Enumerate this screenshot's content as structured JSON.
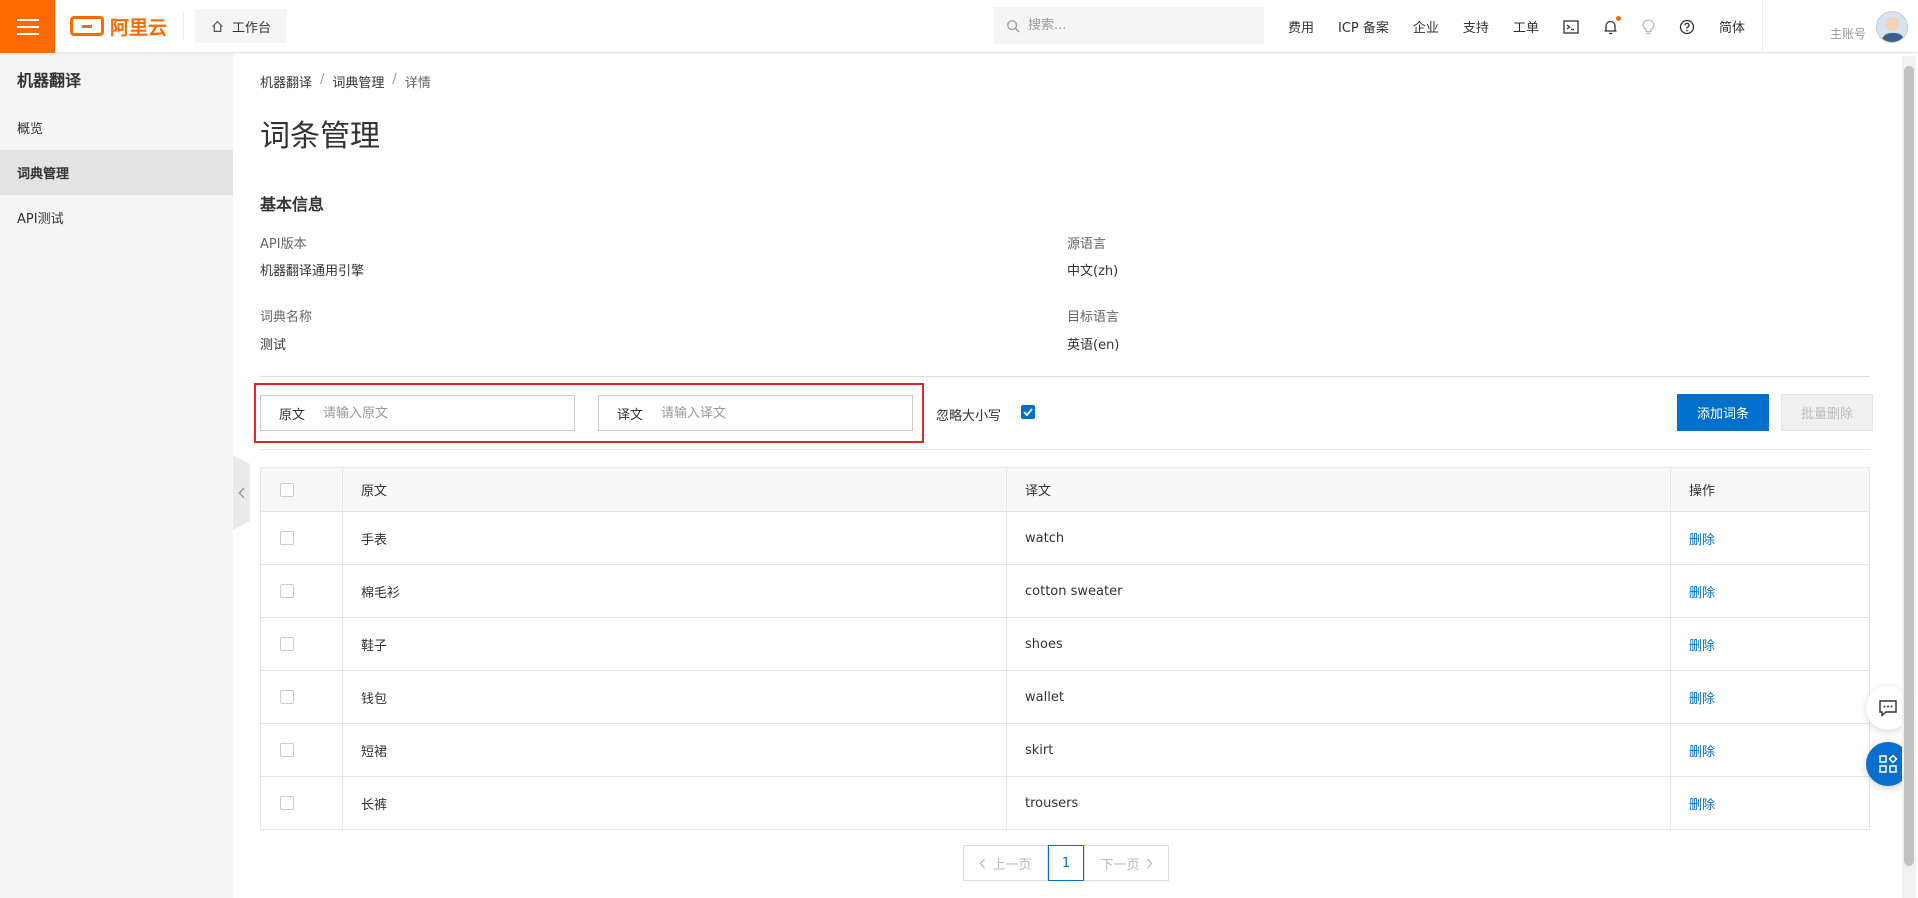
{
  "header": {
    "logo_text": "阿里云",
    "workbench_label": "工作台",
    "search_placeholder": "搜索...",
    "nav": [
      "费用",
      "ICP 备案",
      "企业",
      "支持",
      "工单"
    ],
    "lang": "简体",
    "account": "主账号",
    "brand_color": "#ff6a00"
  },
  "sidebar": {
    "title": "机器翻译",
    "items": [
      {
        "label": "概览"
      },
      {
        "label": "词典管理"
      },
      {
        "label": "API测试"
      }
    ]
  },
  "breadcrumb": [
    "机器翻译",
    "词典管理",
    "详情"
  ],
  "page_title": "词条管理",
  "basic_info": {
    "title": "基本信息",
    "api_version_label": "API版本",
    "api_version": "机器翻译通用引擎",
    "source_lang_label": "源语言",
    "source_lang": "中文(zh)",
    "dict_name_label": "词典名称",
    "dict_name": "测试",
    "target_lang_label": "目标语言",
    "target_lang": "英语(en)"
  },
  "filters": {
    "source_label": "原文",
    "source_placeholder": "请输入原文",
    "target_label": "译文",
    "target_placeholder": "请输入译文",
    "ignore_case_label": "忽略大小写",
    "ignore_case_checked": true
  },
  "actions": {
    "add": "添加词条",
    "batch_delete": "批量删除"
  },
  "table": {
    "headers": [
      "原文",
      "译文",
      "操作"
    ],
    "rows": [
      {
        "src": "手表",
        "tgt": "watch",
        "op": "删除"
      },
      {
        "src": "棉毛衫",
        "tgt": "cotton sweater",
        "op": "删除"
      },
      {
        "src": "鞋子",
        "tgt": "shoes",
        "op": "删除"
      },
      {
        "src": "钱包",
        "tgt": "wallet",
        "op": "删除"
      },
      {
        "src": "短裙",
        "tgt": "skirt",
        "op": "删除"
      },
      {
        "src": "长裤",
        "tgt": "trousers",
        "op": "删除"
      }
    ]
  },
  "pagination": {
    "prev": "上一页",
    "current": "1",
    "next": "下一页"
  },
  "colors": {
    "accent": "#0070cc",
    "highlight_border": "#e0262d"
  }
}
